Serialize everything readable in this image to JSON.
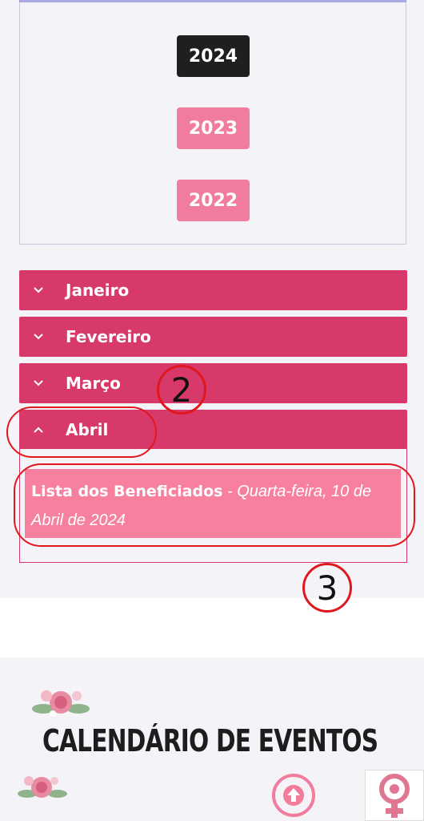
{
  "years": {
    "items": [
      {
        "label": "2024",
        "active": true
      },
      {
        "label": "2023",
        "active": false
      },
      {
        "label": "2022",
        "active": false
      }
    ]
  },
  "months": {
    "items": [
      {
        "label": "Janeiro",
        "expanded": false
      },
      {
        "label": "Fevereiro",
        "expanded": false
      },
      {
        "label": "Março",
        "expanded": false
      },
      {
        "label": "Abril",
        "expanded": true
      }
    ]
  },
  "entry": {
    "title": "Lista dos Beneficiados",
    "separator": " - ",
    "date": "Quarta-feira, 10 de Abril de 2024"
  },
  "annotations": {
    "step2": "2",
    "step3": "3"
  },
  "events": {
    "heading": "CALENDÁRIO DE EVENTOS"
  },
  "colors": {
    "accent": "#d6396a",
    "pink": "#f27c9d",
    "active_year": "#1f1f1f",
    "annotation": "#e0171d"
  }
}
